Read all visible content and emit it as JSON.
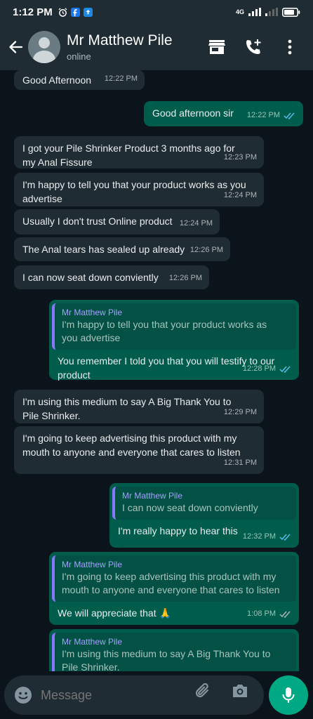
{
  "status_bar": {
    "time": "1:12 PM",
    "network": "4G"
  },
  "header": {
    "contact_name": "Mr Matthew Pile",
    "contact_status": "online"
  },
  "messages": [
    {
      "dir": "in",
      "text": "Good Afternoon",
      "time": "12:22 PM"
    },
    {
      "dir": "out",
      "text": "Good afternoon sir",
      "time": "12:22 PM"
    },
    {
      "dir": "in",
      "text": "I got your Pile Shrinker Product 3 months ago for my Anal Fissure",
      "time": "12:23 PM"
    },
    {
      "dir": "in",
      "text": "I'm happy to tell you that your product works as you advertise",
      "time": "12:24 PM"
    },
    {
      "dir": "in",
      "text": "Usually I don't trust Online product",
      "time": "12:24 PM"
    },
    {
      "dir": "in",
      "text": "The Anal tears has sealed up already",
      "time": "12:26 PM"
    },
    {
      "dir": "in",
      "text": "I can now seat down conviently",
      "time": "12:26 PM"
    },
    {
      "dir": "out",
      "quote_name": "Mr Matthew Pile",
      "quote_text": "I'm happy to tell you that your product works as you advertise",
      "text": "You remember I told you that you will testify to our product",
      "time": "12:28 PM"
    },
    {
      "dir": "in",
      "text": "I'm using this medium to say A Big Thank You to Pile Shrinker.",
      "time": "12:29 PM"
    },
    {
      "dir": "in",
      "text": "I'm going to keep advertising this product with my mouth to anyone and everyone that cares to listen",
      "time": "12:31 PM"
    },
    {
      "dir": "out",
      "quote_name": "Mr Matthew Pile",
      "quote_text": "I can now seat down conviently",
      "text": "I'm really happy to hear this",
      "time": "12:32 PM"
    },
    {
      "dir": "out",
      "quote_name": "Mr Matthew Pile",
      "quote_text": "I'm going to keep advertising this product with my mouth to anyone and everyone that cares to listen",
      "text": "We will appreciate that 🙏",
      "time": "1:08 PM"
    },
    {
      "dir": "out",
      "quote_name": "Mr Matthew Pile",
      "quote_text": "I'm using this medium to say A Big Thank You to Pile Shrinker.",
      "text": "",
      "time": ""
    }
  ],
  "input": {
    "placeholder": "Message"
  },
  "icons": {
    "back": "arrow-left-icon",
    "avatar": "avatar",
    "store": "store-icon",
    "call": "add-call-icon",
    "menu": "more-vert-icon",
    "emoji": "emoji-icon",
    "attach": "paperclip-icon",
    "camera": "camera-icon",
    "mic": "mic-icon",
    "read": "double-check-icon"
  },
  "colors": {
    "header_bg": "#1f2c33",
    "chat_bg": "#0b141a",
    "incoming": "#202c33",
    "outgoing": "#005c4b",
    "accent": "#00a884",
    "read_tick": "#53bdeb"
  }
}
